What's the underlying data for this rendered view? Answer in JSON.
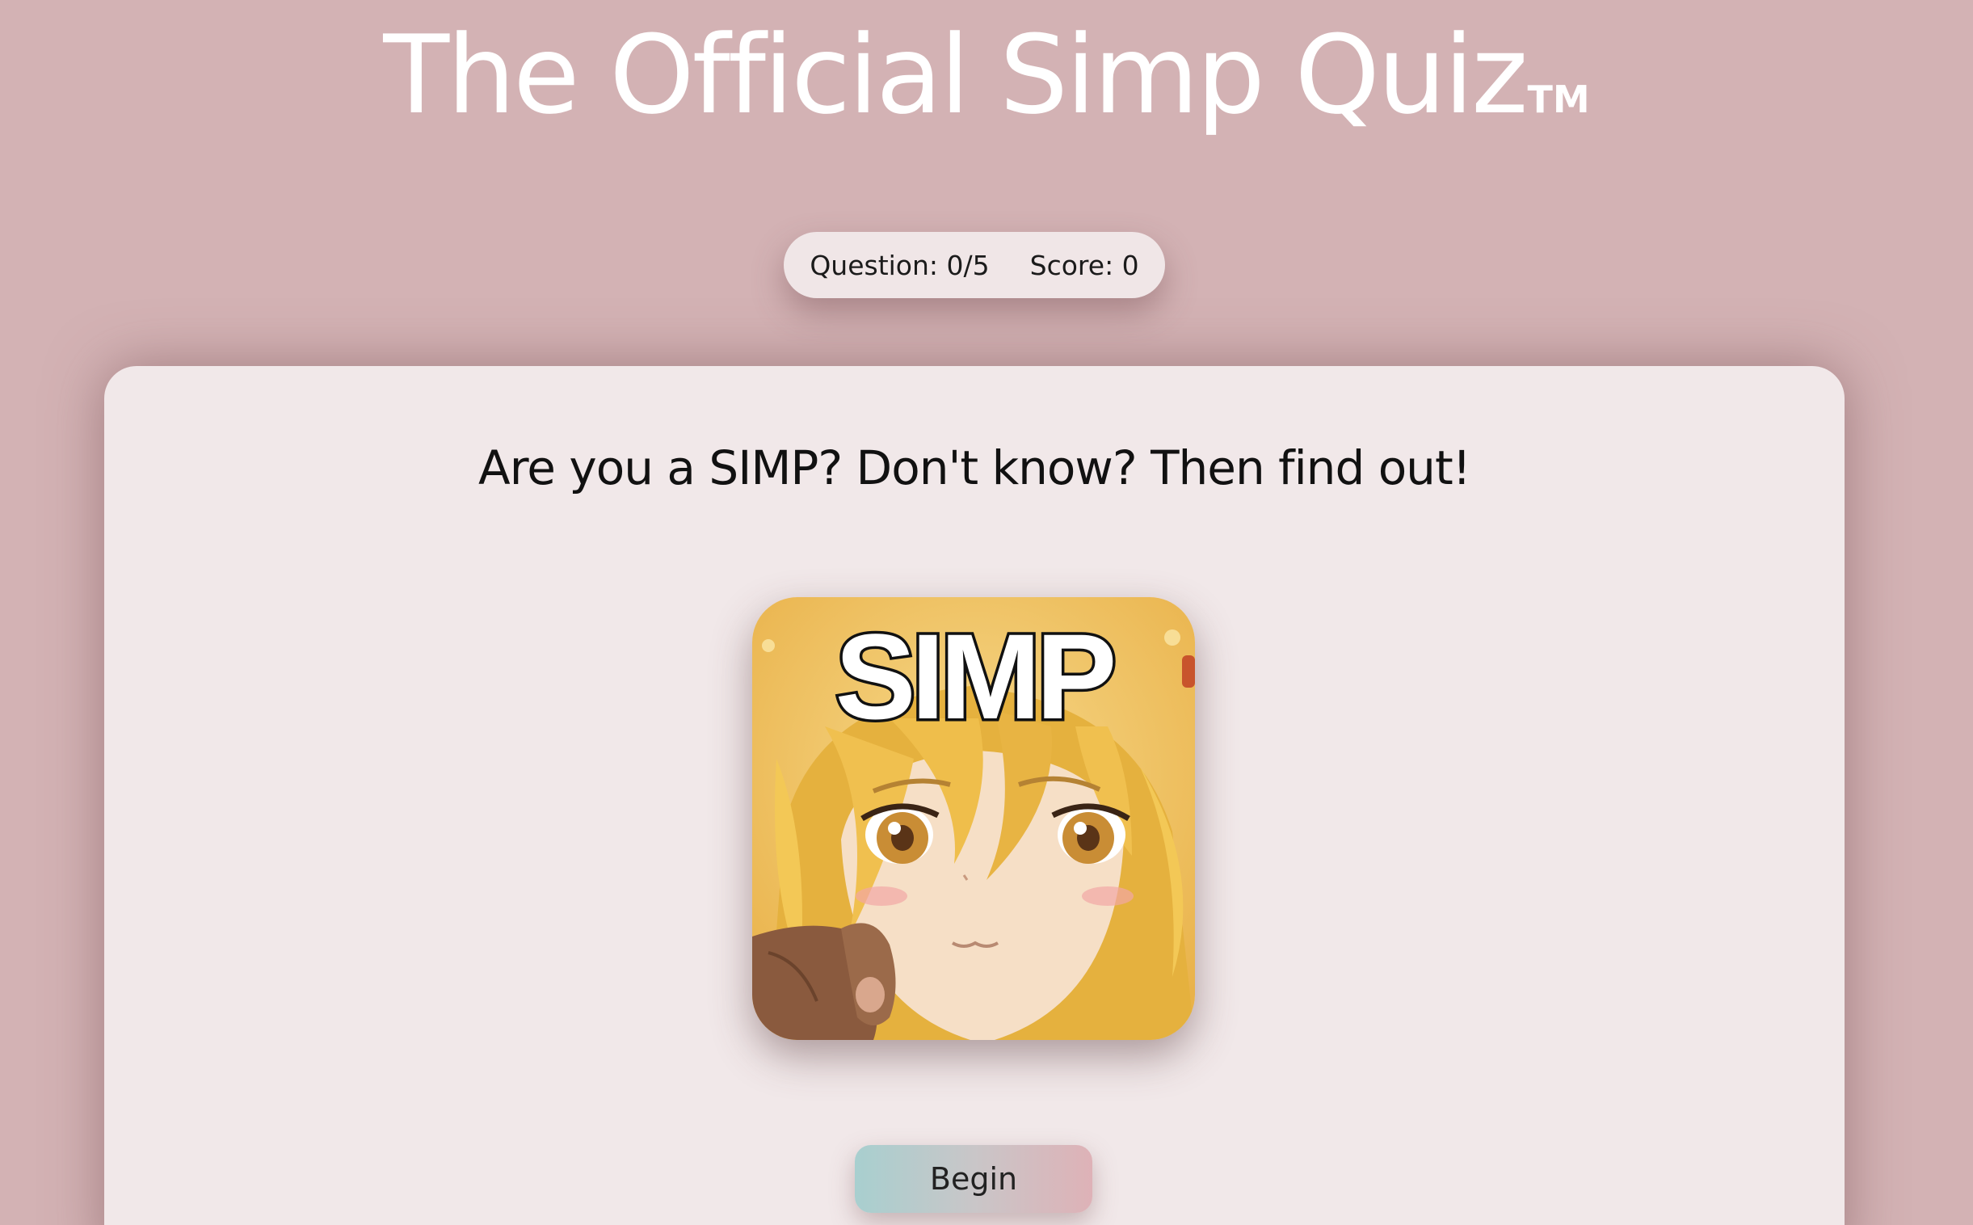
{
  "header": {
    "title": "The Official Simp Quiz",
    "trademark": "TM"
  },
  "stats": {
    "question_label": "Question: 0/5",
    "score_label": "Score: 0"
  },
  "card": {
    "question": "Are you a SIMP? Don't know? Then find out!",
    "image": {
      "caption_text": "SIMP",
      "icon": "anime-girl-pointing-meme-image"
    },
    "begin_label": "Begin"
  },
  "colors": {
    "background": "#d3b2b4",
    "card": "#f1e8e9",
    "pill": "#f0e6e7",
    "button_gradient_start": "#a8cfcf",
    "button_gradient_end": "#deb2b7"
  }
}
